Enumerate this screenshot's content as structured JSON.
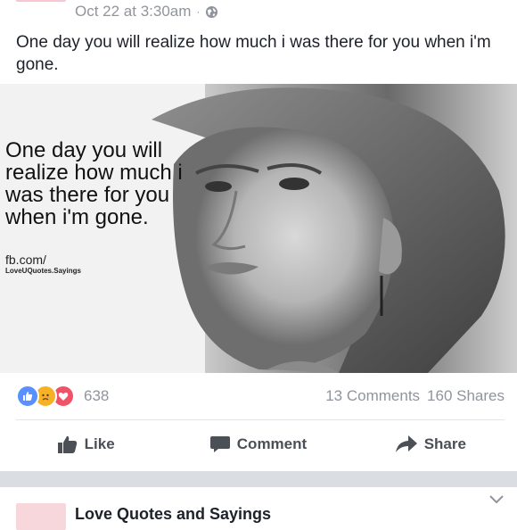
{
  "post": {
    "timestamp": "Oct 22 at 3:30am",
    "separator": "·",
    "privacy_icon": "globe-icon",
    "caption": "One day you will realize how much i was there for you when i'm gone.",
    "image": {
      "overlay_text": "One day you will realize how much i was there for you when i'm gone.",
      "overlay_url": "fb.com/",
      "overlay_page": "LoveUQuotes.Sayings"
    },
    "reactions": {
      "icons": [
        "like-reaction-icon",
        "sad-reaction-icon",
        "love-reaction-icon"
      ],
      "count": "638"
    },
    "comments_count": "13 Comments",
    "shares_count": "160 Shares",
    "actions": {
      "like": "Like",
      "comment": "Comment",
      "share": "Share"
    }
  },
  "next_post": {
    "page_name": "Love Quotes and Sayings",
    "menu_icon": "chevron-down-icon"
  },
  "colors": {
    "meta_text": "#90949c",
    "action_text": "#4b4f56",
    "like_blue": "#5890ff",
    "sad_yellow": "#f7b125",
    "love_red": "#f25268",
    "feed_background": "#dadde1"
  }
}
